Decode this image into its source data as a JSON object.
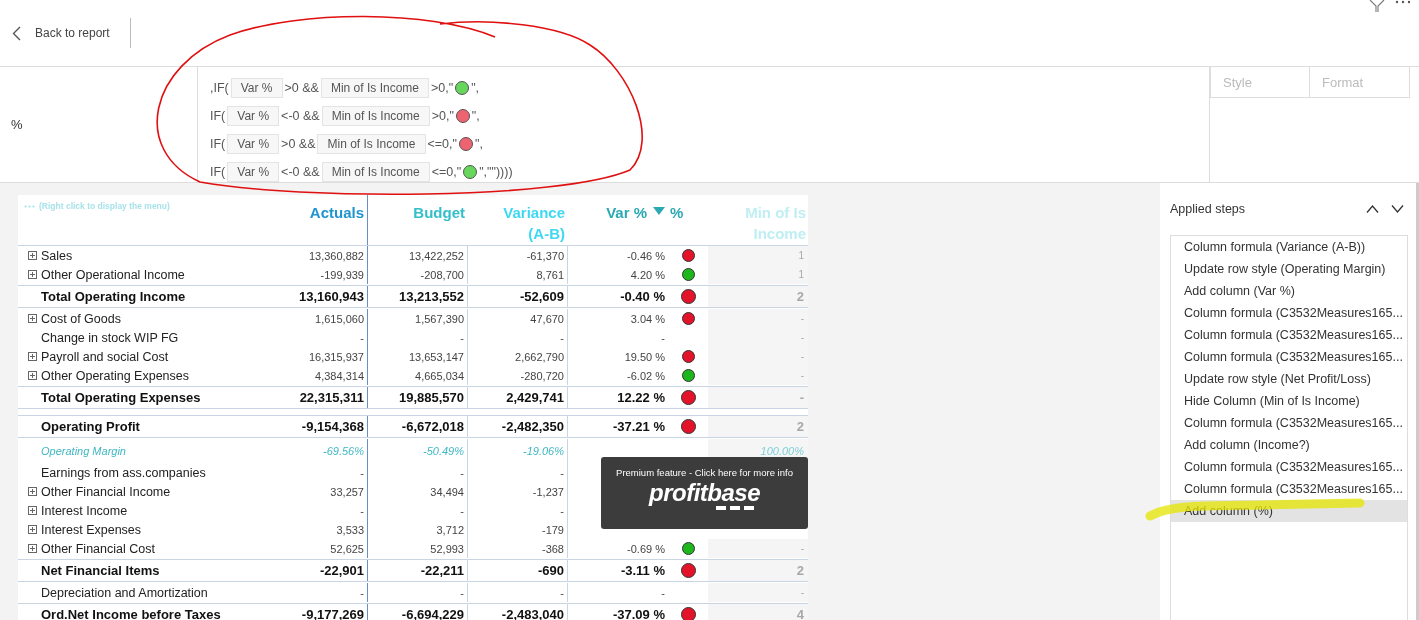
{
  "header": {
    "back_label": "Back to report"
  },
  "formula": {
    "column_label": "%",
    "lines": [
      {
        "parts": [
          {
            "kind": "text",
            "text": ",IF("
          },
          {
            "kind": "chip",
            "text": "Var %"
          },
          {
            "kind": "text",
            "text": ">0 &&"
          },
          {
            "kind": "chip",
            "text": "Min of Is Income"
          },
          {
            "kind": "text",
            "text": ">0,\""
          },
          {
            "kind": "dot",
            "color": "#66d65c"
          },
          {
            "kind": "text",
            "text": "\","
          }
        ]
      },
      {
        "parts": [
          {
            "kind": "text",
            "text": "IF("
          },
          {
            "kind": "chip",
            "text": "Var %"
          },
          {
            "kind": "text",
            "text": "<-0 &&"
          },
          {
            "kind": "chip",
            "text": "Min of Is Income"
          },
          {
            "kind": "text",
            "text": ">0,\""
          },
          {
            "kind": "dot",
            "color": "#ee6370"
          },
          {
            "kind": "text",
            "text": "\","
          }
        ]
      },
      {
        "parts": [
          {
            "kind": "text",
            "text": "IF("
          },
          {
            "kind": "chip",
            "text": "Var %"
          },
          {
            "kind": "text",
            "text": ">0 &&"
          },
          {
            "kind": "chip",
            "text": "Min of Is Income"
          },
          {
            "kind": "text",
            "text": "<=0,\""
          },
          {
            "kind": "dot",
            "color": "#ee6370"
          },
          {
            "kind": "text",
            "text": "\","
          }
        ]
      },
      {
        "parts": [
          {
            "kind": "text",
            "text": "IF("
          },
          {
            "kind": "chip",
            "text": "Var %"
          },
          {
            "kind": "text",
            "text": "<-0 &&"
          },
          {
            "kind": "chip",
            "text": "Min of Is Income"
          },
          {
            "kind": "text",
            "text": "<=0,\""
          },
          {
            "kind": "dot",
            "color": "#66d65c"
          },
          {
            "kind": "text",
            "text": "\",\"\"))))"
          }
        ]
      }
    ]
  },
  "tabs": [
    {
      "label": "Style",
      "selected": false
    },
    {
      "label": "Format",
      "selected": false
    }
  ],
  "table": {
    "menu_hint": "(Right click to display the menu)",
    "columns": [
      {
        "label": "Actuals",
        "color": "#1f95cf"
      },
      {
        "label": "Budget",
        "color": "#33bfc9"
      },
      {
        "label": "Variance (A-B)",
        "color": "#3fd8f2"
      },
      {
        "label": "Var %",
        "color": "#2aa9b3",
        "sorted": true
      },
      {
        "label": "%",
        "color": "#2aa9b3",
        "sorted": false
      },
      {
        "label": "Min of Is Income",
        "color": "#bfeef3",
        "sorted": false
      }
    ],
    "rows": [
      {
        "label": "Sales",
        "kind": "detail",
        "expandable": true,
        "actuals": "13,360,882",
        "budget": "13,422,252",
        "variance": "-61,370",
        "var_pct": "-0.46 %",
        "color": "#e3142a",
        "min": "1"
      },
      {
        "label": "Other Operational Income",
        "kind": "detail",
        "expandable": true,
        "actuals": "-199,939",
        "budget": "-208,700",
        "variance": "8,761",
        "var_pct": "4.20 %",
        "color": "#1db61c",
        "min": "1"
      },
      {
        "label": "Total Operating Income",
        "kind": "total",
        "expandable": false,
        "actuals": "13,160,943",
        "budget": "13,213,552",
        "variance": "-52,609",
        "var_pct": "-0.40 %",
        "color": "#e3142a",
        "min": "2"
      },
      {
        "label": "Cost of Goods",
        "kind": "detail",
        "expandable": true,
        "actuals": "1,615,060",
        "budget": "1,567,390",
        "variance": "47,670",
        "var_pct": "3.04 %",
        "color": "#e3142a",
        "min": "-"
      },
      {
        "label": "Change in stock WIP FG",
        "kind": "detail",
        "expandable": false,
        "actuals": "-",
        "budget": "-",
        "variance": "-",
        "var_pct": "-",
        "min": "-"
      },
      {
        "label": "Payroll and social Cost",
        "kind": "detail",
        "expandable": true,
        "actuals": "16,315,937",
        "budget": "13,653,147",
        "variance": "2,662,790",
        "var_pct": "19.50 %",
        "color": "#e3142a",
        "min": "-"
      },
      {
        "label": "Other Operating Expenses",
        "kind": "detail",
        "expandable": true,
        "actuals": "4,384,314",
        "budget": "4,665,034",
        "variance": "-280,720",
        "var_pct": "-6.02 %",
        "color": "#1db61c",
        "min": "-"
      },
      {
        "label": "Total Operating Expenses",
        "kind": "total",
        "expandable": false,
        "actuals": "22,315,311",
        "budget": "19,885,570",
        "variance": "2,429,741",
        "var_pct": "12.22 %",
        "color": "#e3142a",
        "min": "-"
      },
      {
        "label": "Operating Profit",
        "kind": "total",
        "expandable": false,
        "actuals": "-9,154,368",
        "budget": "-6,672,018",
        "variance": "-2,482,350",
        "var_pct": "-37.21 %",
        "color": "#e3142a",
        "min": "2"
      },
      {
        "label": "Operating Margin",
        "kind": "margin",
        "expandable": false,
        "actuals": "-69.56%",
        "budget": "-50.49%",
        "variance": "-19.06%",
        "min": "100.00%"
      },
      {
        "label": "Earnings from ass.companies",
        "kind": "detail",
        "expandable": false,
        "actuals": "-",
        "budget": "-",
        "variance": "-"
      },
      {
        "label": "Other Financial Income",
        "kind": "detail",
        "expandable": true,
        "actuals": "33,257",
        "budget": "34,494",
        "variance": "-1,237"
      },
      {
        "label": "Interest Income",
        "kind": "detail",
        "expandable": true,
        "actuals": "-",
        "budget": "-",
        "variance": "-"
      },
      {
        "label": "Interest Expenses",
        "kind": "detail",
        "expandable": true,
        "actuals": "3,533",
        "budget": "3,712",
        "variance": "-179"
      },
      {
        "label": "Other Financial Cost",
        "kind": "detail",
        "expandable": true,
        "actuals": "52,625",
        "budget": "52,993",
        "variance": "-368",
        "var_pct": "-0.69 %",
        "color": "#1db61c",
        "min": "-"
      },
      {
        "label": "Net Financial Items",
        "kind": "total",
        "expandable": false,
        "actuals": "-22,901",
        "budget": "-22,211",
        "variance": "-690",
        "var_pct": "-3.11 %",
        "color": "#e3142a",
        "min": "2"
      },
      {
        "label": "Depreciation and Amortization",
        "kind": "detail",
        "expandable": false,
        "actuals": "-",
        "budget": "-",
        "variance": "-",
        "var_pct": "-",
        "min": "-"
      },
      {
        "label": "Ord.Net Income before Taxes",
        "kind": "total",
        "expandable": false,
        "actuals": "-9,177,269",
        "budget": "-6,694,229",
        "variance": "-2,483,040",
        "var_pct": "-37.09 %",
        "color": "#e3142a",
        "min": "4"
      }
    ]
  },
  "tooltip": {
    "text": "Premium feature - Click here for more info",
    "logo": "profitbase"
  },
  "applied_steps": {
    "title": "Applied steps",
    "items": [
      {
        "label": "Column formula (Variance (A-B))",
        "selected": false
      },
      {
        "label": "Update row style (Operating Margin)",
        "selected": false
      },
      {
        "label": "Add column (Var %)",
        "selected": false
      },
      {
        "label": "Column formula (C3532Measures165...",
        "selected": false
      },
      {
        "label": "Column formula (C3532Measures165...",
        "selected": false
      },
      {
        "label": "Column formula (C3532Measures165...",
        "selected": false
      },
      {
        "label": "Update row style (Net Profit/Loss)",
        "selected": false
      },
      {
        "label": "Hide Column (Min of Is Income)",
        "selected": false
      },
      {
        "label": "Column formula (C3532Measures165...",
        "selected": false
      },
      {
        "label": "Add column (Income?)",
        "selected": false
      },
      {
        "label": "Column formula (C3532Measures165...",
        "selected": false
      },
      {
        "label": "Column formula (C3532Measures165...",
        "selected": false
      },
      {
        "label": "Add column (%)",
        "selected": true
      }
    ]
  }
}
